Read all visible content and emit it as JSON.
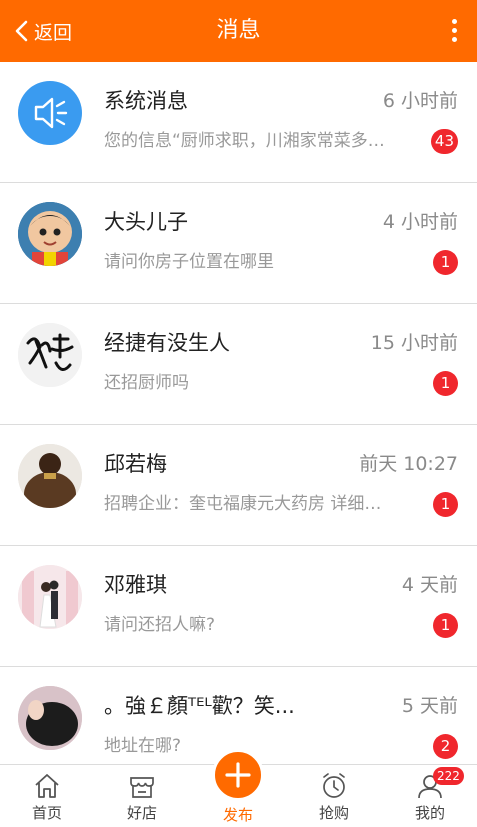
{
  "header": {
    "back_label": "返回",
    "title": "消息",
    "more_icon": "more-vertical-icon"
  },
  "colors": {
    "accent": "#ff6a00",
    "badge": "#f0272d"
  },
  "messages": [
    {
      "name": "系统消息",
      "time": "6 小时前",
      "preview": "您的信息“厨师求职，川湘家常菜多…",
      "count": "43",
      "avatar": "speaker-icon"
    },
    {
      "name": "大头儿子",
      "time": "4 小时前",
      "preview": "请问你房子位置在哪里",
      "count": "1",
      "avatar": "cartoon-boy"
    },
    {
      "name": "经捷有没生人",
      "time": "15 小时前",
      "preview": "还招厨师吗",
      "count": "1",
      "avatar": "calligraphy"
    },
    {
      "name": "邱若梅",
      "time": "前天 10:27",
      "preview": "招聘企业：奎屯福康元大药房 详细…",
      "count": "1",
      "avatar": "hair-bun-photo"
    },
    {
      "name": "邓雅琪",
      "time": "4 天前",
      "preview": "请问还招人嘛?",
      "count": "1",
      "avatar": "wedding-photo"
    },
    {
      "name": "。強￡顏ᵀᴱᴸ歡？笑...",
      "time": "5 天前",
      "preview": "地址在哪?",
      "count": "2",
      "avatar": "dark-hair-photo"
    }
  ],
  "tabbar": {
    "items": [
      {
        "label": "首页",
        "icon": "home-icon"
      },
      {
        "label": "好店",
        "icon": "shop-icon"
      },
      {
        "label": "发布",
        "icon": "plus-icon"
      },
      {
        "label": "抢购",
        "icon": "alarm-clock-icon"
      },
      {
        "label": "我的",
        "icon": "user-icon",
        "badge": "222"
      }
    ]
  }
}
